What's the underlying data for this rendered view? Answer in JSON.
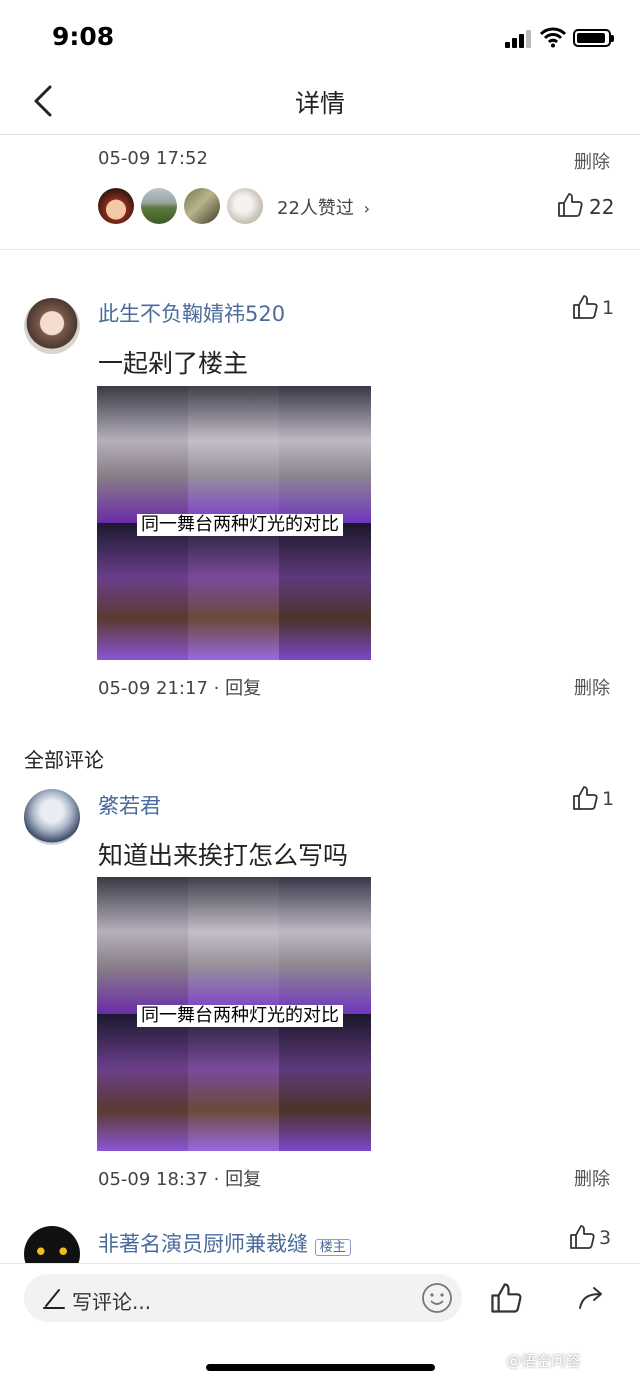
{
  "status_bar": {
    "time": "9:08"
  },
  "nav": {
    "title": "详情"
  },
  "post": {
    "timestamp": "05-09 17:52",
    "delete_label": "删除",
    "likers_summary": "22人赞过",
    "like_count": "22"
  },
  "comments": [
    {
      "username": "此生不负鞠婧祎520",
      "text": "一起剁了楼主",
      "image_caption": "同一舞台两种灯光的对比",
      "timestamp": "05-09 21:17",
      "reply_label": "· 回复",
      "delete_label": "删除",
      "likes": "1"
    }
  ],
  "all_comments": {
    "title": "全部评论",
    "items": [
      {
        "username": "綮若君",
        "text": "知道出来挨打怎么写吗",
        "image_caption": "同一舞台两种灯光的对比",
        "timestamp": "05-09 18:37",
        "reply_label": "· 回复",
        "delete_label": "删除",
        "likes": "1"
      },
      {
        "username": "非著名演员厨师兼裁缝",
        "badge": "楼主",
        "likes": "3"
      }
    ]
  },
  "bottom_bar": {
    "placeholder": "写评论..."
  },
  "watermark": "@悟空问答",
  "icons": [
    "back-icon",
    "thumb-up-icon",
    "pen-icon",
    "emoji-icon",
    "share-icon",
    "chevron-right-icon"
  ],
  "colors": {
    "username": "#4a6b9c",
    "stage_purple": "#7a3fd0"
  }
}
